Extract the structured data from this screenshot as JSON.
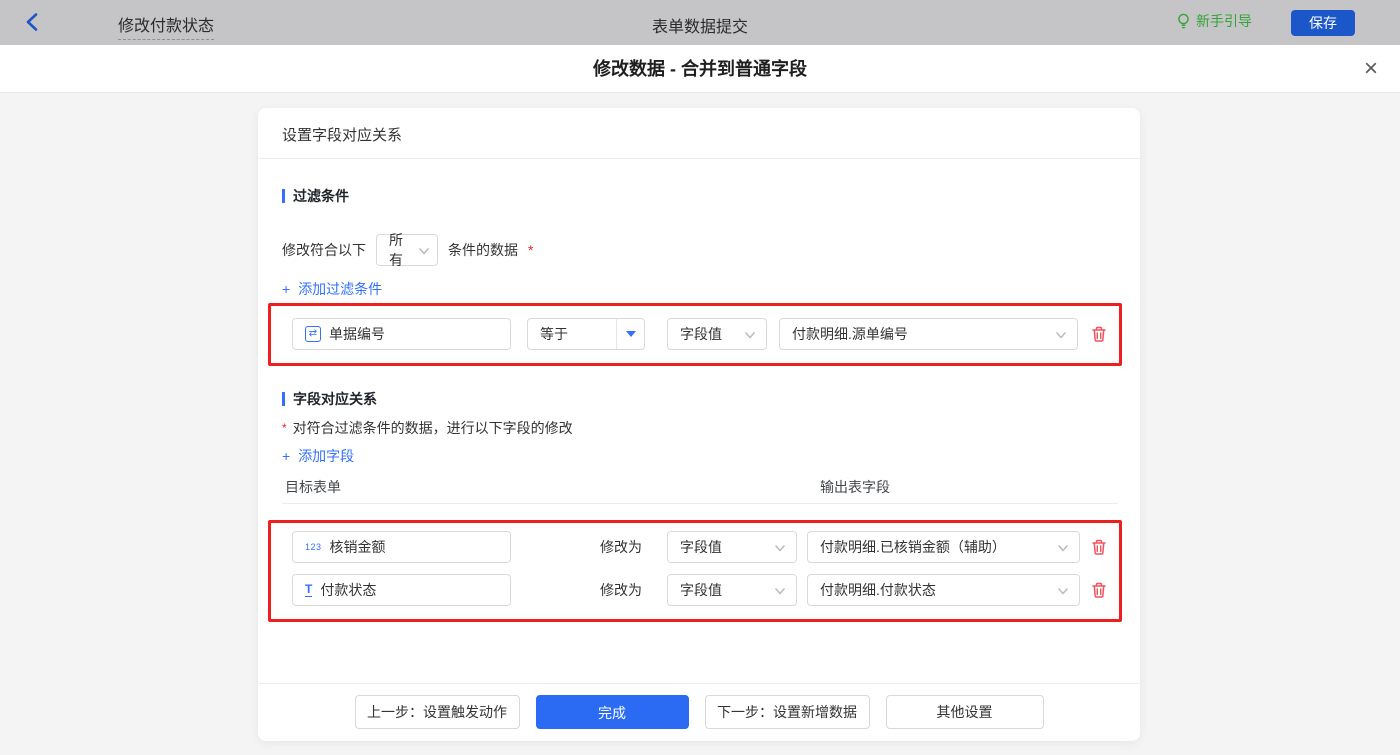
{
  "topbar": {
    "back_title": "修改付款状态",
    "center_title": "表单数据提交",
    "guide_label": "新手引导",
    "save_label": "保存"
  },
  "dialog": {
    "title": "修改数据 - 合并到普通字段",
    "close_glyph": "×"
  },
  "card": {
    "header": "设置字段对应关系",
    "filter_section": {
      "title": "过滤条件",
      "match_prefix": "修改符合以下",
      "match_mode": "所有",
      "match_suffix": "条件的数据",
      "required_mark": "*",
      "add_icon": "+",
      "add_label": "添加过滤条件",
      "row": {
        "field_icon_glyph": "⇄",
        "field_label": "单据编号",
        "operator": "等于",
        "value_type": "字段值",
        "value": "付款明细.源单编号"
      }
    },
    "mapping_section": {
      "title": "字段对应关系",
      "required_mark": "*",
      "desc": "对符合过滤条件的数据，进行以下字段的修改",
      "add_icon": "+",
      "add_label": "添加字段",
      "col_target": "目标表单",
      "col_output": "输出表字段",
      "modify_label": "修改为",
      "rows": [
        {
          "icon_text": "123",
          "field_label": "核销金额",
          "value_type": "字段值",
          "value": "付款明细.已核销金额（辅助）"
        },
        {
          "icon_text": "T",
          "field_label": "付款状态",
          "value_type": "字段值",
          "value": "付款明细.付款状态"
        }
      ]
    },
    "footer": {
      "prev_label": "上一步：设置触发动作",
      "done_label": "完成",
      "next_label": "下一步：设置新增数据",
      "other_label": "其他设置"
    }
  },
  "colors": {
    "accent_blue": "#3370ff",
    "primary_button_blue": "#2b6bf3",
    "topbar_save_blue": "#1c57c9",
    "guide_green": "#36a339",
    "danger_red": "#f5222d",
    "annotation_red": "#ee1f1f",
    "trash_red": "#f2525e",
    "topbar_bg": "#c5c5c7",
    "page_bg": "#f4f4f5",
    "control_border": "#d9d9d9"
  }
}
